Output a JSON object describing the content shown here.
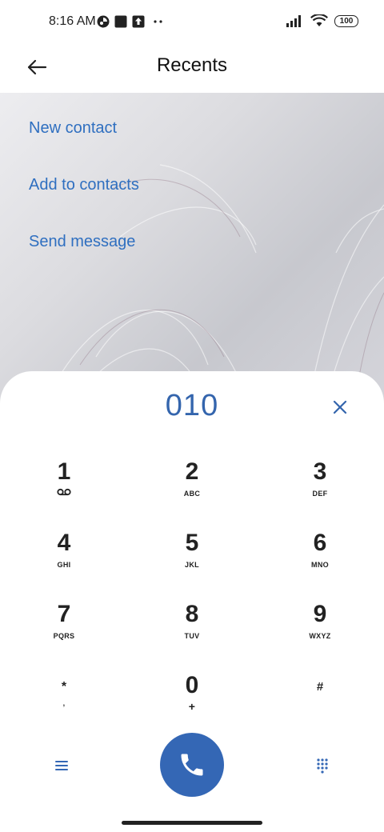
{
  "status_bar": {
    "time": "8:16 AM",
    "battery": "100",
    "icons": [
      "app-icon-1",
      "square-icon",
      "upload-icon",
      "more-dots-icon",
      "signal-icon",
      "wifi-icon",
      "battery-icon"
    ]
  },
  "header": {
    "title": "Recents",
    "back_icon": "arrow-left-icon"
  },
  "actions": [
    {
      "label": "New contact"
    },
    {
      "label": "Add to contacts"
    },
    {
      "label": "Send message"
    }
  ],
  "dialer": {
    "number": "010",
    "keys": [
      {
        "digit": "1",
        "letters": ""
      },
      {
        "digit": "2",
        "letters": "ABC"
      },
      {
        "digit": "3",
        "letters": "DEF"
      },
      {
        "digit": "4",
        "letters": "GHI"
      },
      {
        "digit": "5",
        "letters": "JKL"
      },
      {
        "digit": "6",
        "letters": "MNO"
      },
      {
        "digit": "7",
        "letters": "PQRS"
      },
      {
        "digit": "8",
        "letters": "TUV"
      },
      {
        "digit": "9",
        "letters": "WXYZ"
      },
      {
        "digit": "*",
        "letters": ","
      },
      {
        "digit": "0",
        "letters": "+"
      },
      {
        "digit": "#",
        "letters": ""
      }
    ]
  },
  "colors": {
    "accent": "#3467b5",
    "link": "#2f6fc0",
    "number": "#3465ad"
  }
}
